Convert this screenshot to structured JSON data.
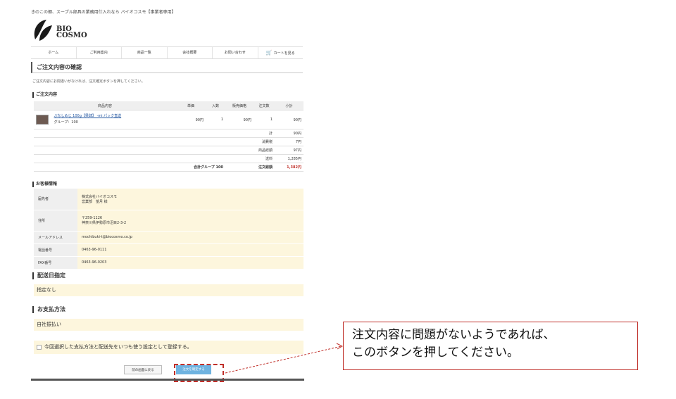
{
  "header": {
    "tagline": "きのこの郷、スープル部具の業務用仕入れなら バイオコスモ【事業者専用】",
    "logo_text_1": "BIO",
    "logo_text_2": "COSMO"
  },
  "nav": {
    "items": [
      "ホーム",
      "ご利用案内",
      "商品一覧",
      "会社概要",
      "お問い合わせ",
      "カートを見る"
    ]
  },
  "page_title": "ご注文内容の確認",
  "intro_text": "ご注文内容にお間違いがなければ、注文確定ボタンを押してください。",
  "order_section": {
    "heading": "ご注文内容",
    "columns": [
      "商品内容",
      "単価",
      "入数",
      "販売価格",
      "注文数",
      "小計"
    ],
    "product": {
      "name": "ぶなしめじ 100g【果肆】 -mi パック直送",
      "group": "グループ：100",
      "unit_price": "90円",
      "qty_per": "1",
      "sale_price": "90円",
      "order_qty": "1",
      "subtotal": "90円"
    },
    "summary": [
      {
        "label": "計",
        "value": "90円"
      },
      {
        "label": "消費税",
        "value": "7円"
      },
      {
        "label": "商品総額",
        "value": "97円"
      },
      {
        "label": "送料",
        "value": "1,285円"
      }
    ],
    "group_total_label": "合計グループ 100",
    "order_total_label": "注文総額",
    "order_total_value": "1,382円"
  },
  "customer_section": {
    "heading": "お客様情報",
    "rows": [
      {
        "label": "届先者",
        "value_1": "株式会社バイオコスモ",
        "value_2": "営業部　望月 様"
      },
      {
        "label": "住所",
        "value_1": "〒259-1126",
        "value_2": "神奈川県伊勢原市沼目2-3-2"
      },
      {
        "label": "メールアドレス",
        "value_1": "mochibuki-t@biocosmo.co.jp",
        "value_2": ""
      },
      {
        "label": "電話番号",
        "value_1": "0463-96-0111",
        "value_2": ""
      },
      {
        "label": "FAX番号",
        "value_1": "0463-96-0203",
        "value_2": ""
      }
    ]
  },
  "delivery_section": {
    "heading": "配送日指定",
    "value": "指定なし"
  },
  "payment_section": {
    "heading": "お支払方法",
    "value": "自社振払い"
  },
  "save_option_label": "今回選択した支払方法と配送先をいつも使う設定として登録する。",
  "buttons": {
    "back": "前の画面に戻る",
    "confirm": "注文を確定する"
  },
  "callout": {
    "line1": "注文内容に問題がないようであれば、",
    "line2": "このボタンを押してください。"
  },
  "colors": {
    "accent_red": "#c0302a",
    "confirm_blue": "#6fb3e0",
    "highlight_bg": "#fdf6dd"
  }
}
